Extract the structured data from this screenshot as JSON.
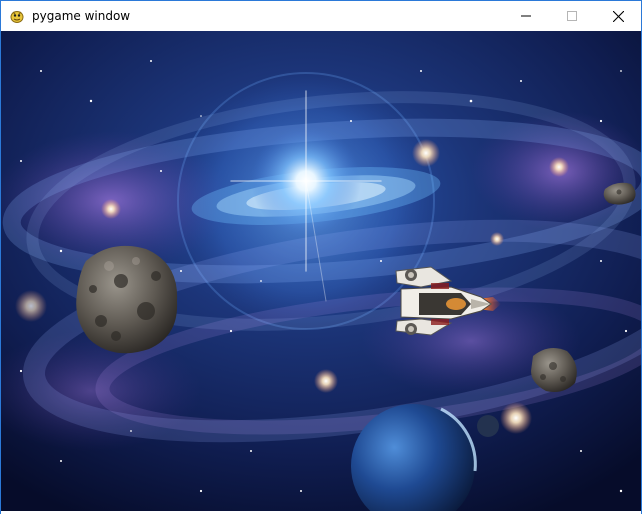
{
  "window": {
    "title": "pygame window",
    "app_icon": "pygame-snake-icon",
    "controls": [
      "minimize-icon",
      "maximize-icon",
      "close-icon"
    ]
  },
  "game": {
    "background": "galaxy-space-background",
    "sprites": [
      "player-spaceship",
      "large-asteroid",
      "small-asteroid",
      "tiny-asteroid",
      "planet"
    ],
    "colors": {
      "space_deep": "#0b1640",
      "galaxy_glow": "#bfe3ff",
      "nebula_purple": "#8f5bd6",
      "planet_blue": "#1e4f9a",
      "thruster_orange": "#ff9a2b"
    }
  }
}
